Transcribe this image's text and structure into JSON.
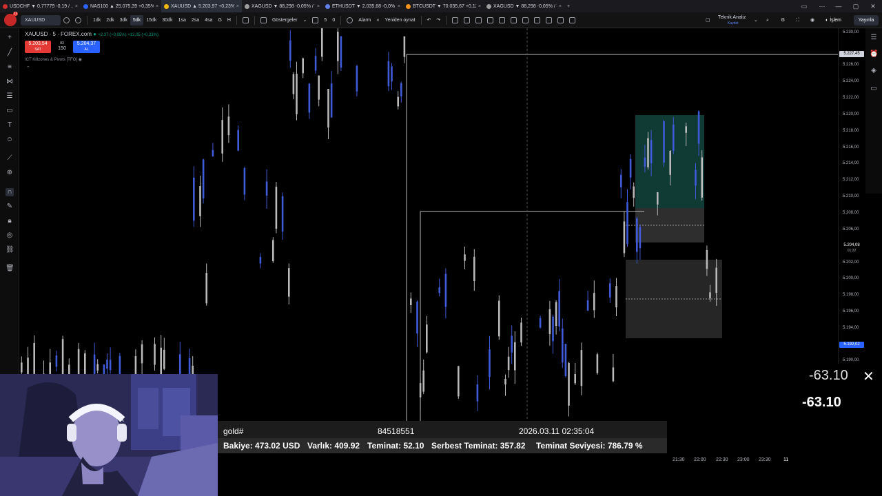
{
  "tabs": [
    {
      "label": "USDCHF ▼ 0,77779 -0,19 / ...",
      "color": "#d32f2f",
      "active": false
    },
    {
      "label": "NAS100 ▲ 25.075,39 +0,35% ...",
      "color": "#2962ff",
      "active": false
    },
    {
      "label": "XAUUSD ▲ 5.203,97 +0,23% ...",
      "color": "#f0b90b",
      "active": true
    },
    {
      "label": "XAGUSD ▼ 88,298 -0,05% / Tekn...",
      "color": "#9e9e9e",
      "active": false
    },
    {
      "label": "ETHUSDT ▼ 2.035,68 -0,0% ...",
      "color": "#627eea",
      "active": false
    },
    {
      "label": "BTCUSDT ▼ 70.035,67 +0,12 ...",
      "color": "#f7931a",
      "active": false
    },
    {
      "label": "XAGUSD ▼ 88,298 -0,05% / Tekn...",
      "color": "#9e9e9e",
      "active": false
    }
  ],
  "window_controls": [
    "▭",
    "⋯",
    "—",
    "▢",
    "✕"
  ],
  "toolbar": {
    "symbol": "XAUUSD",
    "timeframes": [
      "1dk",
      "2dk",
      "3dk",
      "5dk",
      "15dk",
      "30dk",
      "1sa",
      "2sa",
      "4sa",
      "G",
      "H"
    ],
    "active_timeframe": "5dk",
    "indicators_label": "Göstergeler",
    "alarm_label": "Alarm",
    "replay_label": "Yeniden oynat",
    "counter1": "5",
    "counter2": "0",
    "analysis_title": "Teknik Analiz",
    "analysis_sub": "Kaydet",
    "trade_label": "İşlem",
    "publish_label": "Yayınla",
    "avatar_badge": "11"
  },
  "legend": {
    "title": "XAUUSD · 5 · FOREX.com",
    "change": "+2,37 (+0,05%) +12,05 (+0,23%)",
    "sell_price": "5.203,54",
    "sell_label": "SAT",
    "spread_top": "83",
    "spread_bottom": "150",
    "buy_price": "5.204,37",
    "buy_label": "AL",
    "indicator": "ICT Killzones & Pivots [TFO]"
  },
  "price_axis": {
    "labels": [
      "5.230,00",
      "5.226,00",
      "5.224,00",
      "5.222,00",
      "5.220,00",
      "5.218,00",
      "5.216,00",
      "5.214,00",
      "5.212,00",
      "5.210,00",
      "5.208,00",
      "5.206,00",
      "5.202,00",
      "5.200,00",
      "5.198,00",
      "5.196,00",
      "5.194,00",
      "5.190,00"
    ],
    "tag_top": "5.227,45",
    "tag_last": "5.204,08",
    "tag_countdown": "01:22",
    "tag_blue": "5.192,02"
  },
  "info": {
    "symbol": "gold#",
    "ticket": "84518551",
    "datetime": "2026.03.11 02:35:04",
    "balance": "Bakiye: 473.02 USD",
    "equity": "Varlık: 409.92",
    "margin": "Teminat: 52.10",
    "free_margin": "Serbest Teminat: 357.82",
    "margin_level": "Teminat Seviyesi: 786.79 %"
  },
  "pnl": {
    "value1": "-63.10",
    "value2": "-63.10",
    "close_icon": "✕"
  },
  "time_axis": [
    "21:30",
    "22:00",
    "22:30",
    "23:00",
    "23:30",
    "11"
  ],
  "colors": {
    "bull": "#3f5bd9",
    "bear": "#b9b9b9",
    "green_zone": "#12403a",
    "grey_zone": "#2a2a2a",
    "accent": "#2962ff",
    "sell": "#e53935"
  }
}
